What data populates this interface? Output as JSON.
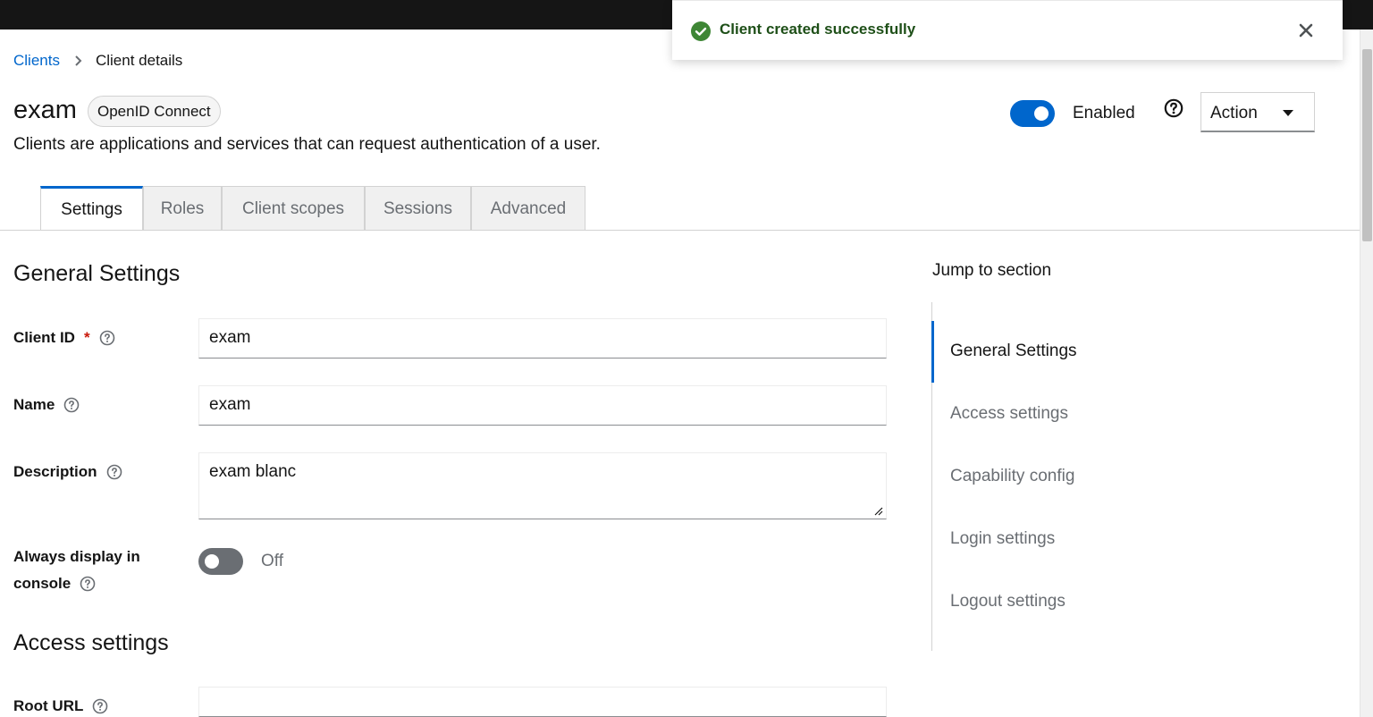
{
  "toast": {
    "message": "Client created successfully"
  },
  "breadcrumb": {
    "parent": "Clients",
    "current": "Client details"
  },
  "header": {
    "title": "exam",
    "badge": "OpenID Connect",
    "subtitle": "Clients are applications and services that can request authentication of a user.",
    "enabled_label": "Enabled",
    "enabled": true,
    "action_label": "Action"
  },
  "tabs": [
    {
      "label": "Settings",
      "active": true
    },
    {
      "label": "Roles",
      "active": false
    },
    {
      "label": "Client scopes",
      "active": false
    },
    {
      "label": "Sessions",
      "active": false
    },
    {
      "label": "Advanced",
      "active": false
    }
  ],
  "general": {
    "title": "General Settings",
    "client_id_label": "Client ID",
    "client_id_required": "*",
    "client_id_value": "exam",
    "name_label": "Name",
    "name_value": "exam",
    "description_label": "Description",
    "description_value": "exam blanc",
    "always_display_label_1": "Always display in",
    "always_display_label_2": "console",
    "always_display_state": "Off"
  },
  "access": {
    "title": "Access settings",
    "root_url_label": "Root URL",
    "root_url_value": ""
  },
  "jump": {
    "title": "Jump to section",
    "items": [
      {
        "label": "General Settings",
        "active": true
      },
      {
        "label": "Access settings",
        "active": false
      },
      {
        "label": "Capability config",
        "active": false
      },
      {
        "label": "Login settings",
        "active": false
      },
      {
        "label": "Logout settings",
        "active": false
      }
    ]
  },
  "colors": {
    "accent": "#0066cc",
    "success": "#3e8635",
    "required": "#c9190b"
  }
}
